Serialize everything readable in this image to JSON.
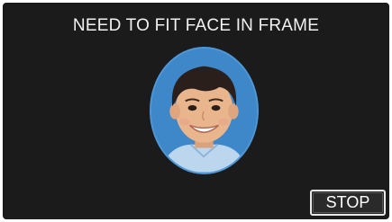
{
  "screen": {
    "message": "NEED TO FIT FACE IN FRAME",
    "face_frame_icon": "child-face-photo",
    "frame_color": "#3a86c8"
  },
  "controls": {
    "stop_label": "STOP"
  }
}
